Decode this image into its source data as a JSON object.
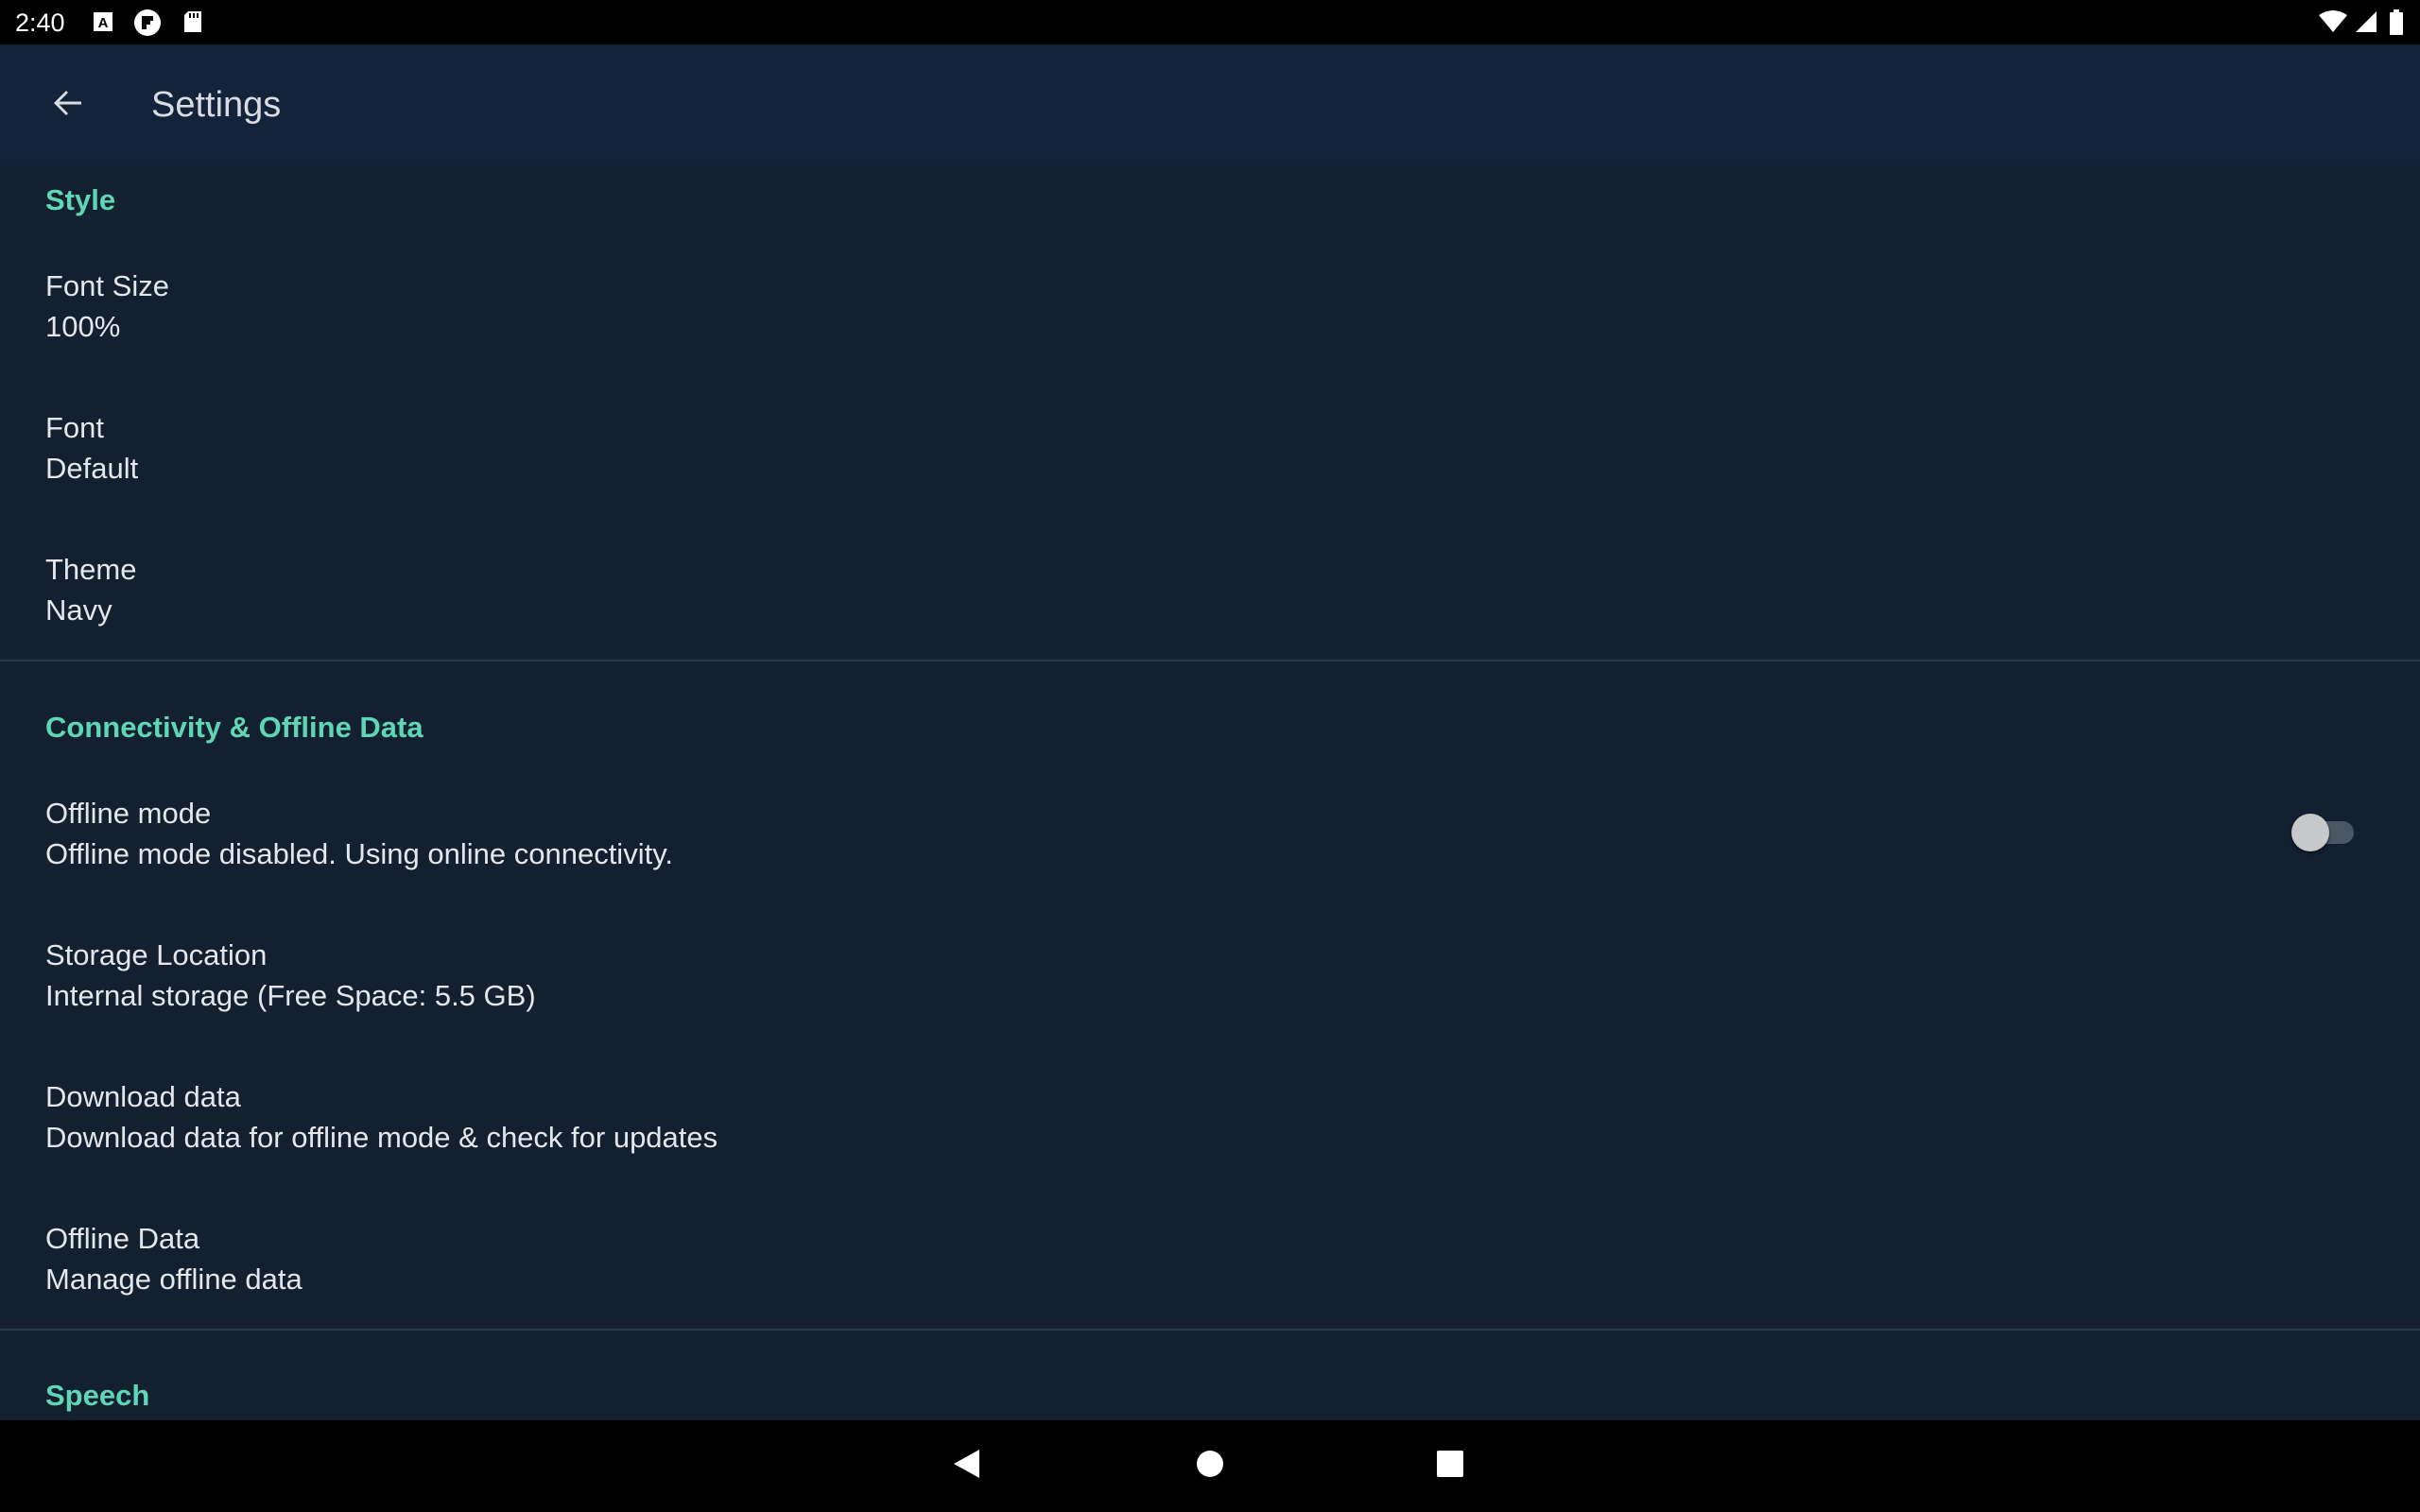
{
  "status_bar": {
    "time": "2:40",
    "left_icons": [
      "a-notification-icon",
      "flipboard-icon",
      "sd-card-icon"
    ],
    "right_icons": [
      "wifi-icon",
      "cell-signal-icon",
      "battery-icon"
    ]
  },
  "app_bar": {
    "back_icon": "arrow-back-icon",
    "title": "Settings"
  },
  "sections": {
    "style": {
      "header": "Style",
      "font_size": {
        "title": "Font Size",
        "summary": "100%"
      },
      "font": {
        "title": "Font",
        "summary": "Default"
      },
      "theme": {
        "title": "Theme",
        "summary": "Navy"
      }
    },
    "connectivity": {
      "header": "Connectivity & Offline Data",
      "offline_mode": {
        "title": "Offline mode",
        "summary": "Offline mode disabled. Using online connectivity.",
        "enabled": false
      },
      "storage_location": {
        "title": "Storage Location",
        "summary": "Internal storage (Free Space: 5.5 GB)"
      },
      "download_data": {
        "title": "Download data",
        "summary": "Download data for offline mode & check for updates"
      },
      "offline_data": {
        "title": "Offline Data",
        "summary": "Manage offline data"
      }
    },
    "speech": {
      "header": "Speech"
    }
  },
  "nav_bar": {
    "buttons": [
      "nav-back-icon",
      "nav-home-icon",
      "nav-recents-icon"
    ]
  },
  "colors": {
    "background": "#12202f",
    "app_bar": "#13233a",
    "accent": "#5fd6b6",
    "text_primary": "#e3e7ec",
    "divider": "#26394b"
  }
}
